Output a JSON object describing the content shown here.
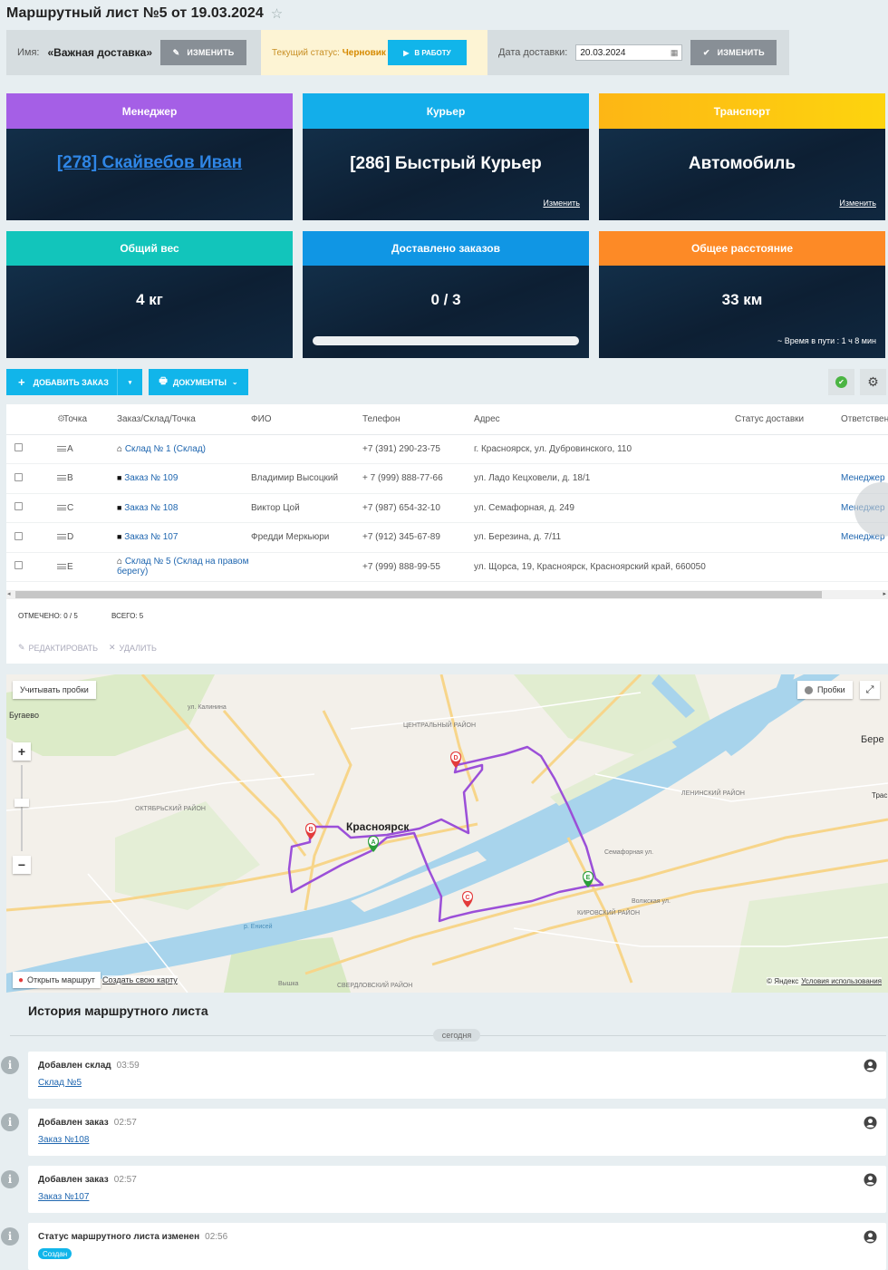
{
  "page": {
    "title": "Маршрутный лист №5 от 19.03.2024"
  },
  "info": {
    "name_label": "Имя:",
    "name_value": "«Важная доставка»",
    "change_label": "Изменить",
    "status_label": "Текущий статус:",
    "status_value": "Черновик",
    "to_work_label": "В работу",
    "date_label": "Дата доставки:",
    "date_value": "20.03.2024",
    "date_change_label": "Изменить"
  },
  "cards": {
    "manager": {
      "title": "Менеджер",
      "value": "[278] Скайвебов Иван",
      "color": "#a55fe6"
    },
    "courier": {
      "title": "Курьер",
      "value": "[286] Быстрый Курьер",
      "change": "Изменить",
      "color": "#13aeea"
    },
    "transport": {
      "title": "Транспорт",
      "value": "Автомобиль",
      "change": "Изменить",
      "color": "#fdc60f"
    },
    "weight": {
      "title": "Общий вес",
      "value": "4 кг",
      "color": "#12c5bb"
    },
    "delivered": {
      "title": "Доставлено заказов",
      "value": "0 / 3",
      "progress": 0,
      "color": "#1096e4"
    },
    "distance": {
      "title": "Общее расстояние",
      "value": "33 км",
      "meta": "~ Время в пути : 1 ч 8 мин",
      "color": "#fd8a26"
    }
  },
  "toolbar": {
    "add_order": "Добавить заказ",
    "documents": "Документы"
  },
  "table": {
    "headers": [
      "Точка",
      "Заказ/Склад/Точка",
      "ФИО",
      "Телефон",
      "Адрес",
      "Статус доставки",
      "Ответствен"
    ],
    "rows": [
      {
        "point": "A",
        "order": "Склад № 1 (Склад)",
        "icon": "warehouse-icon",
        "name": "",
        "phone": "+7 (391) 290-23-75",
        "address": "г. Красноярск, ул. Дубровинского, 110",
        "status": "",
        "resp": ""
      },
      {
        "point": "B",
        "order": "Заказ № 109",
        "icon": "bag-icon",
        "name": "Владимир Высоцкий",
        "phone": "+ 7 (999) 888-77-66",
        "address": "ул. Ладо Кецховели, д. 18/1",
        "status": "",
        "resp": "Менеджер"
      },
      {
        "point": "C",
        "order": "Заказ № 108",
        "icon": "bag-icon",
        "name": "Виктор Цой",
        "phone": "+7 (987) 654-32-10",
        "address": "ул. Семафорная, д. 249",
        "status": "",
        "resp": "Менеджер"
      },
      {
        "point": "D",
        "order": "Заказ № 107",
        "icon": "bag-icon",
        "name": "Фредди Меркьюри",
        "phone": "+7 (912) 345-67-89",
        "address": "ул. Березина, д. 7/11",
        "status": "",
        "resp": "Менеджер"
      },
      {
        "point": "E",
        "order": "Склад № 5 (Склад на правом берегу)",
        "icon": "warehouse-icon",
        "name": "",
        "phone": "+7 (999) 888-99-55",
        "address": "ул. Щорса, 19, Красноярск, Красноярский край, 660050",
        "status": "",
        "resp": ""
      }
    ],
    "marked": "Отмечено: 0 / 5",
    "total": "Всего: 5",
    "edit": "Редактировать",
    "delete": "Удалить"
  },
  "map": {
    "traffic_toggle": "Учитывать пробки",
    "traffic": "Пробки",
    "open_route": "Открыть маршрут",
    "create_map": "Создать свою карту",
    "copyright": "© Яндекс",
    "terms": "Условия использования",
    "city": "Красноярск",
    "labels": {
      "bugaevo": "Бугаево",
      "bere": "Бере",
      "tra": "Трас",
      "central": "ЦЕНТРАЛЬНЫЙ РАЙОН",
      "oktyabr": "ОКТЯБРЬСКИЙ РАЙОН",
      "lenin": "ЛЕНИНСКИЙ РАЙОН",
      "kirov": "КИРОВСКИЙ РАЙОН",
      "sverdl": "СВЕРДЛОВСКИЙ РАЙОН",
      "yenisei": "р. Енисей",
      "kalinina": "ул. Калинина",
      "semafor": "Семафорная ул.",
      "volzh": "Волжская ул.",
      "vyshka": "Вышка"
    }
  },
  "history": {
    "title": "История маршрутного листа",
    "today": "сегодня",
    "items": [
      {
        "title": "Добавлен склад",
        "time": "03:59",
        "link": "Склад №5"
      },
      {
        "title": "Добавлен заказ",
        "time": "02:57",
        "link": "Заказ №108"
      },
      {
        "title": "Добавлен заказ",
        "time": "02:57",
        "link": "Заказ №107"
      },
      {
        "title": "Статус маршрутного листа изменен",
        "time": "02:56",
        "badge": "Создан"
      }
    ]
  }
}
